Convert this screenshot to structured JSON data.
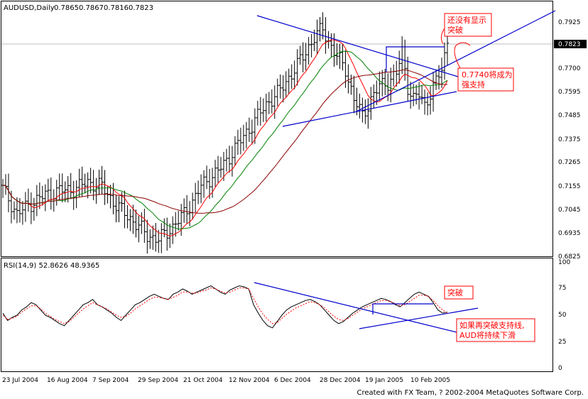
{
  "chart_data": [
    {
      "type": "ohlc",
      "title": "AUDUSD,Daily",
      "ohlc_header": [
        "0.7865",
        "0.7867",
        "0.7816",
        "0.7823"
      ],
      "current_price_label": "0.7823",
      "current_price": 0.7823,
      "y_ticks": [
        "0.7925",
        "0.7815",
        "0.7700",
        "0.7595",
        "0.7485",
        "0.7375",
        "0.7265",
        "0.7155",
        "0.7045",
        "0.6935",
        "0.6825"
      ],
      "ylim": [
        0.6825,
        0.7925
      ],
      "x_ticks": [
        "23 Jul 2004",
        "16 Aug 2004",
        "7 Sep 2004",
        "29 Sep 2004",
        "21 Oct 2004",
        "12 Nov 2004",
        "6 Dec 2004",
        "28 Dec 2004",
        "19 Jan 2005",
        "10 Feb 2005"
      ],
      "num_bars": 158,
      "close_anchors": [
        [
          0,
          0.714
        ],
        [
          5,
          0.702
        ],
        [
          10,
          0.707
        ],
        [
          15,
          0.711
        ],
        [
          20,
          0.713
        ],
        [
          25,
          0.7135
        ],
        [
          30,
          0.717
        ],
        [
          35,
          0.715
        ],
        [
          40,
          0.706
        ],
        [
          45,
          0.7
        ],
        [
          48,
          0.696
        ],
        [
          51,
          0.692
        ],
        [
          55,
          0.69
        ],
        [
          60,
          0.696
        ],
        [
          64,
          0.702
        ],
        [
          67,
          0.708
        ],
        [
          70,
          0.715
        ],
        [
          74,
          0.72
        ],
        [
          78,
          0.725
        ],
        [
          82,
          0.733
        ],
        [
          86,
          0.74
        ],
        [
          90,
          0.748
        ],
        [
          94,
          0.755
        ],
        [
          98,
          0.76
        ],
        [
          102,
          0.768
        ],
        [
          106,
          0.776
        ],
        [
          110,
          0.785
        ],
        [
          113,
          0.789
        ],
        [
          115,
          0.783
        ],
        [
          118,
          0.776
        ],
        [
          121,
          0.77
        ],
        [
          124,
          0.756
        ],
        [
          127,
          0.748
        ],
        [
          130,
          0.756
        ],
        [
          133,
          0.762
        ],
        [
          136,
          0.764
        ],
        [
          139,
          0.768
        ],
        [
          141,
          0.778
        ],
        [
          143,
          0.762
        ],
        [
          145,
          0.756
        ],
        [
          147,
          0.758
        ],
        [
          149,
          0.753
        ],
        [
          151,
          0.759
        ],
        [
          153,
          0.764
        ],
        [
          155,
          0.77
        ],
        [
          157,
          0.7823
        ]
      ],
      "ma_sets": [
        {
          "color": "#ff0000",
          "period": 10
        },
        {
          "color": "#008000",
          "period": 20
        },
        {
          "color": "#8b0000",
          "period": 40
        }
      ],
      "annotations": [
        {
          "lines": [
            "还没有显示",
            "突破"
          ]
        },
        {
          "lines": [
            "0.7740将成为",
            "强支持"
          ]
        }
      ]
    },
    {
      "type": "line",
      "title": "RSI(14,9) 52.8626 48.9365",
      "y_ticks": [
        "100",
        "75",
        "50",
        "25",
        "0"
      ],
      "ylim": [
        0,
        100
      ],
      "series": [
        {
          "values": [
            52,
            45,
            48,
            50,
            55,
            58,
            62,
            60,
            55,
            50,
            48,
            45,
            42,
            40,
            45,
            50,
            55,
            60,
            62,
            65,
            60,
            58,
            55,
            52,
            48,
            45,
            50,
            55,
            60,
            62,
            65,
            68,
            70,
            68,
            66,
            65,
            70,
            72,
            75,
            73,
            70,
            72,
            74,
            76,
            78,
            75,
            72,
            70,
            74,
            76,
            78,
            77,
            75,
            60,
            52,
            45,
            40,
            38,
            44,
            50,
            55,
            58,
            60,
            62,
            64,
            65,
            63,
            60,
            55,
            50,
            45,
            42,
            44,
            48,
            52,
            55,
            58,
            60,
            62,
            64,
            66,
            65,
            63,
            60,
            58,
            62,
            66,
            70,
            72,
            70,
            68,
            62,
            55,
            52,
            53
          ]
        },
        {
          "values": [
            50,
            46,
            47,
            49,
            53,
            56,
            59,
            59,
            56,
            52,
            49,
            46,
            44,
            42,
            44,
            48,
            52,
            56,
            59,
            62,
            60,
            58,
            56,
            53,
            50,
            48,
            49,
            52,
            56,
            59,
            62,
            65,
            67,
            67,
            66,
            65,
            67,
            69,
            72,
            72,
            71,
            71,
            73,
            74,
            76,
            75,
            73,
            71,
            72,
            74,
            76,
            76,
            75,
            66,
            58,
            51,
            46,
            42,
            43,
            47,
            51,
            54,
            57,
            59,
            61,
            63,
            62,
            60,
            57,
            53,
            49,
            46,
            45,
            47,
            50,
            53,
            56,
            58,
            60,
            62,
            64,
            64,
            63,
            61,
            59,
            60,
            63,
            66,
            69,
            69,
            68,
            64,
            59,
            55,
            52
          ]
        }
      ],
      "annotations": [
        {
          "lines": [
            "突破"
          ]
        },
        {
          "lines": [
            "如果再突破支持线,",
            "AUD将持续下滑"
          ]
        }
      ]
    }
  ],
  "footer": "Created with FX Team, ? 2002-2004 MetaQuotes Software Corp."
}
